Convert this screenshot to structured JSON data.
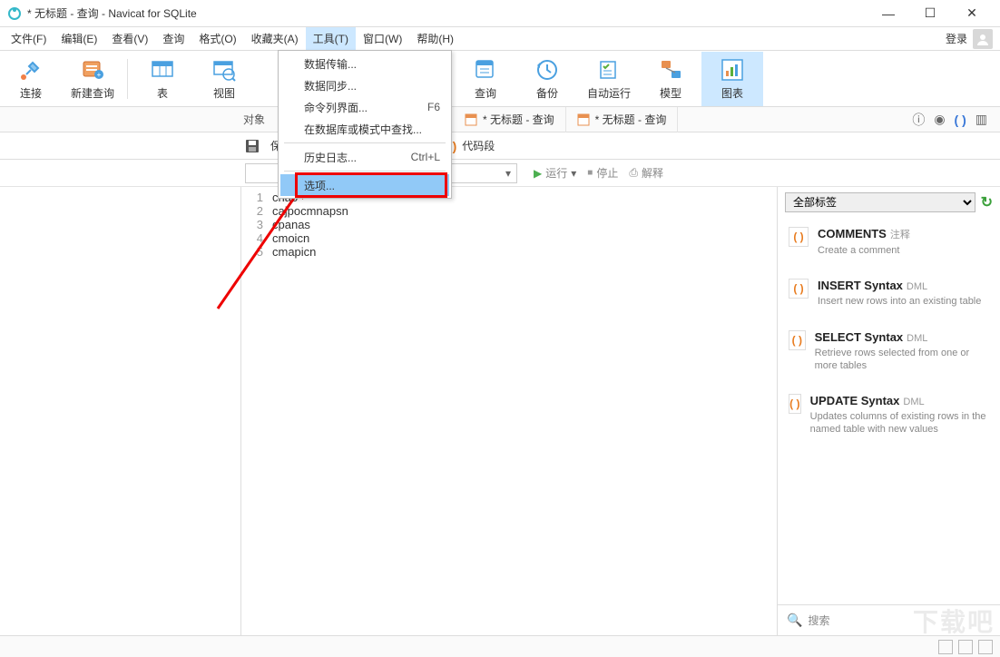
{
  "window": {
    "title": "* 无标题 - 查询 - Navicat for SQLite"
  },
  "menubar": {
    "items": [
      "文件(F)",
      "编辑(E)",
      "查看(V)",
      "查询",
      "格式(O)",
      "收藏夹(A)",
      "工具(T)",
      "窗口(W)",
      "帮助(H)"
    ],
    "login": "登录",
    "open_index": 6
  },
  "toolbar": {
    "connect": "连接",
    "newquery": "新建查询",
    "table": "表",
    "view": "视图",
    "query": "查询",
    "backup": "备份",
    "autorun": "自动运行",
    "model": "模型",
    "chart": "图表"
  },
  "dropdown": {
    "items": [
      {
        "label": "数据传输...",
        "shortcut": ""
      },
      {
        "label": "数据同步...",
        "shortcut": ""
      },
      {
        "label": "命令列界面...",
        "shortcut": "F6"
      },
      {
        "label": "在数据库或模式中查找...",
        "shortcut": ""
      },
      {
        "label": "历史日志...",
        "shortcut": "Ctrl+L"
      },
      {
        "label": "选项...",
        "shortcut": ""
      }
    ],
    "highlight_index": 5,
    "sep_after": [
      3,
      4
    ]
  },
  "tabs": {
    "objects": "对象",
    "tab1": "* 无标题 - 查询",
    "tab2": "* 无标题 - 查询"
  },
  "subtools": {
    "save": "保存",
    "codeseg": "代码段"
  },
  "runbar": {
    "run": "运行",
    "stop": "停止",
    "explain": "解释"
  },
  "editor": {
    "lines": [
      "cnao",
      "cajpocmnapsn",
      "cpanas",
      "cmoicn",
      "cmapicn"
    ]
  },
  "rightpanel": {
    "filter": "全部标签",
    "snippets": [
      {
        "title": "COMMENTS",
        "tag": "注释",
        "desc": "Create a comment"
      },
      {
        "title": "INSERT Syntax",
        "tag": "DML",
        "desc": "Insert new rows into an existing table"
      },
      {
        "title": "SELECT Syntax",
        "tag": "DML",
        "desc": "Retrieve rows selected from one or more tables"
      },
      {
        "title": "UPDATE Syntax",
        "tag": "DML",
        "desc": "Updates columns of existing rows in the named table with new values"
      }
    ],
    "search_placeholder": "搜索"
  },
  "watermark": "下载吧"
}
